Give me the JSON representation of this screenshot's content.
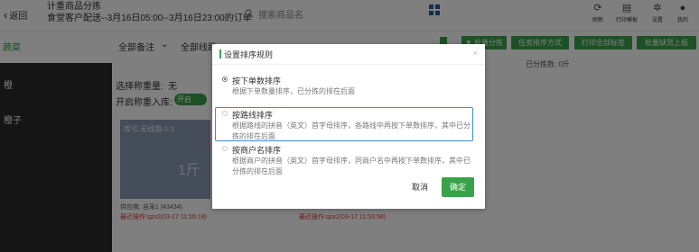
{
  "header": {
    "back_label": "返回",
    "title": "计重商品分拣",
    "subtitle": "食堂客户配送--3月16日05:00--3月16日23:00的订单",
    "search_placeholder": "搜索商品名",
    "tools": [
      {
        "icon": "refresh-icon",
        "glyph": "⟳",
        "label": "刷新"
      },
      {
        "icon": "printer-icon",
        "glyph": "▤",
        "label": "打印模板"
      },
      {
        "icon": "gear-icon",
        "glyph": "✲",
        "label": "设置"
      },
      {
        "icon": "user-icon",
        "glyph": "●",
        "label": "我的"
      }
    ]
  },
  "toolbar": {
    "left_green": "蔬菜",
    "filter_note": "全部备注",
    "filter_route": "全部线路",
    "buttons": [
      "▼ 批量分拣",
      "任务排序方式",
      "打印全部标签",
      "批量缺货上报"
    ]
  },
  "sidebar": {
    "items": [
      "橙",
      "橙子"
    ]
  },
  "main": {
    "count_label": "已分拣数:",
    "count_value": "0斤",
    "weigh_repeat_label": "选择称重量:",
    "weigh_repeat_value": "无",
    "reweigh_label": "开启称重入库:",
    "reweigh_toggle": "开启",
    "card_top": "库号:无线路-1-1",
    "card_big": "1斤",
    "card_supplier": "供应商: 自采1 (43434)",
    "card_op1": "最近操作:qzx2(03-17 11:55:19)",
    "card_op2": "最近操作:qzx2(03-17 11:53:58)"
  },
  "modal": {
    "title": "设置排序规则",
    "close": "×",
    "options": [
      {
        "title": "按下单数排序",
        "desc": "根据下单数量排序，已分拣的排在后面",
        "checked": true
      },
      {
        "title": "按路线排序",
        "desc": "根据路线的拼音（英文）首字母排序，各路线中再按下单数排序，其中已分拣的排在后面",
        "checked": false
      },
      {
        "title": "按商户名排序",
        "desc": "根据商户的拼音（英文）首字母排序，同商户名中再按下单数排序，其中已分拣的排在后面",
        "checked": false
      }
    ],
    "cancel": "取消",
    "ok": "确定"
  },
  "colors": {
    "accent_green": "#39a24a",
    "focus_blue": "#3a8fd6",
    "sidebar_dark": "#2b2b2b",
    "op_red": "#d9322b"
  }
}
